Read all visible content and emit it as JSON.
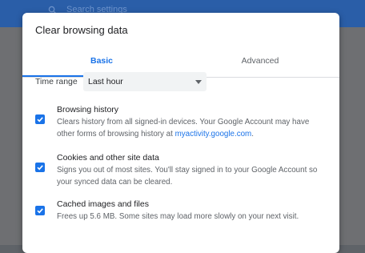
{
  "background": {
    "search_placeholder": "Search settings"
  },
  "dialog": {
    "title": "Clear browsing data",
    "tabs": [
      {
        "label": "Basic",
        "active": true
      },
      {
        "label": "Advanced",
        "active": false
      }
    ],
    "time_range": {
      "label": "Time range",
      "value": "Last hour"
    },
    "options": [
      {
        "title": "Browsing history",
        "desc_line1": "Clears history from all signed-in devices. Your Google Account may have",
        "desc_line2_prefix": "other forms of browsing history at ",
        "desc_link": "myactivity.google.com",
        "desc_line2_suffix": ".",
        "checked": true
      },
      {
        "title": "Cookies and other site data",
        "desc_line1": "Signs you out of most sites. You'll stay signed in to your Google Account so",
        "desc_line2": "your synced data can be cleared.",
        "checked": true
      },
      {
        "title": "Cached images and files",
        "desc_line1": "Frees up 5.6 MB. Some sites may load more slowly on your next visit.",
        "checked": true
      }
    ]
  },
  "colors": {
    "accent": "#1a73e8",
    "header": "#2a5ea8",
    "overlay": "#6e6f72"
  }
}
